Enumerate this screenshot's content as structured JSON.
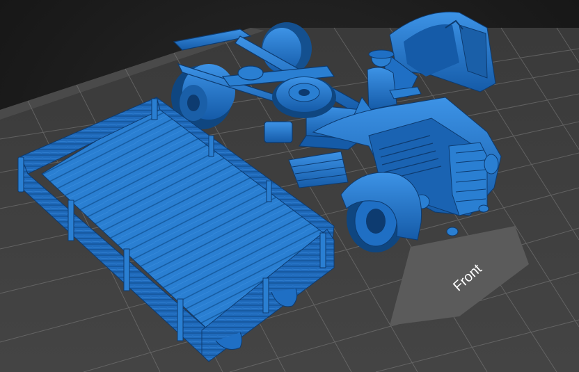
{
  "viewport": {
    "front_label": "Front"
  },
  "colors": {
    "background": "#1b1b1b",
    "plate": "#3c3c3c",
    "plate_edge": "#4a4a4a",
    "grid": "#8a8a8a",
    "front_marker": "#5a5a5a",
    "front_text": "#ffffff",
    "model_blue": "#1f6fc4",
    "model_blue_light": "#3d93e6",
    "model_blue_dark": "#0e3f78"
  },
  "scene": {
    "objects": [
      "cargo-bed",
      "truck-chassis",
      "truck-cab",
      "driver-figure",
      "spare-wheel",
      "front-wheel",
      "rear-wheels"
    ]
  }
}
